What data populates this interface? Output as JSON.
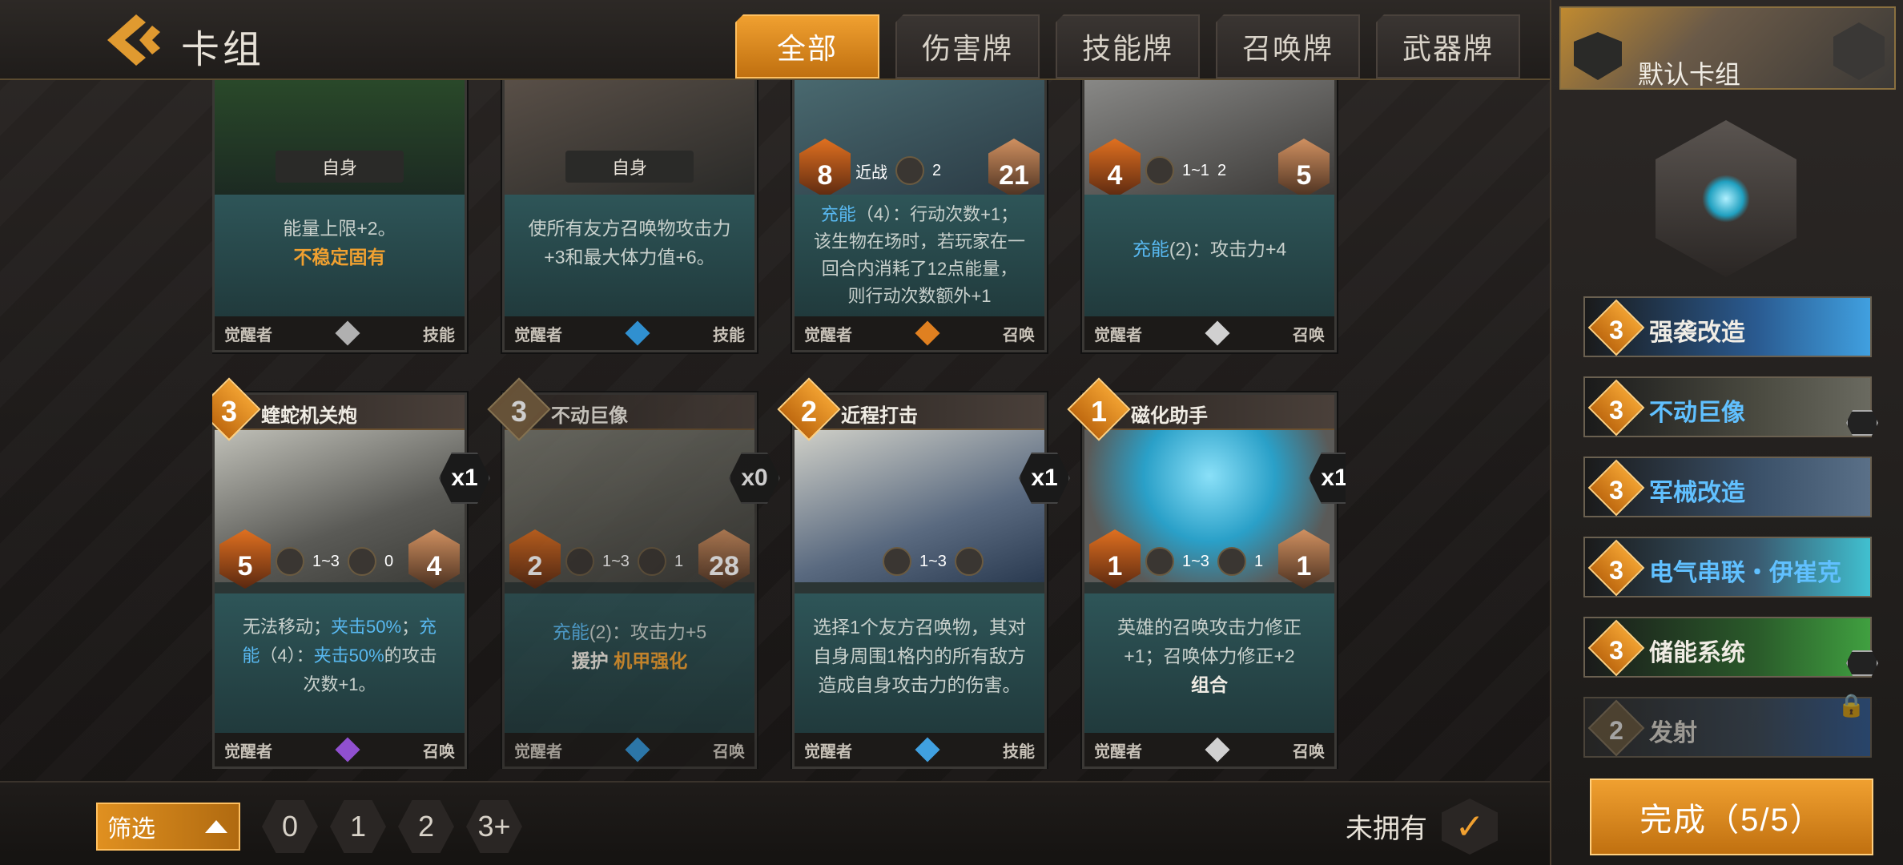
{
  "header": {
    "title": "卡组"
  },
  "tabs": [
    {
      "label": "全部",
      "active": true
    },
    {
      "label": "伤害牌"
    },
    {
      "label": "技能牌"
    },
    {
      "label": "召唤牌"
    },
    {
      "label": "武器牌"
    }
  ],
  "top_cards": [
    {
      "tag": "自身",
      "desc1": "能量上限+2。",
      "desc2": "不稳定固有",
      "owner": "觉醒者",
      "type": "技能",
      "gem": "#b0b0b0"
    },
    {
      "tag": "自身",
      "desc1": "使所有友方召唤物攻击力",
      "desc2": "+3和最大体力值+6。",
      "owner": "觉醒者",
      "type": "技能",
      "gem": "#3090d0"
    },
    {
      "atk": "8",
      "range": "近战",
      "spd": "2",
      "hp": "21",
      "kw": "充能",
      "desc1": "（4）：行动次数+1；",
      "desc2": "该生物在场时，若玩家在一",
      "desc3": "回合内消耗了12点能量，",
      "desc4": "则行动次数额外+1",
      "owner": "觉醒者",
      "type": "召唤",
      "gem": "#e08020"
    },
    {
      "atk": "4",
      "range": "1~1",
      "spd": "2",
      "hp": "5",
      "kw": "充能",
      "desc1": "(2)：攻击力+4",
      "owner": "觉醒者",
      "type": "召唤",
      "gem": "#d0d0d0"
    }
  ],
  "cards": [
    {
      "cost": "3",
      "name": "蝰蛇机关炮",
      "copies": "x1",
      "atk": "5",
      "range": "1~3",
      "spd": "0",
      "hp": "4",
      "d_a": "无法移动；",
      "d_b": "夹击50%",
      "d_c": "；",
      "d_d": "充",
      "d_e": "能",
      "d_f": "（4）：",
      "d_g": "夹击50%",
      "d_h": "的攻击",
      "d_i": "次数+1。",
      "owner": "觉醒者",
      "type": "召唤",
      "gem": "#9050d0"
    },
    {
      "cost": "3",
      "name": "不动巨像",
      "copies": "x0",
      "atk": "2",
      "range": "1~3",
      "spd": "1",
      "hp": "28",
      "kw": "充能",
      "d1": "(2)：攻击力+5",
      "d2a": "援护",
      "d2b": "机甲强化",
      "owner": "觉醒者",
      "type": "召唤",
      "gem": "#3090d0"
    },
    {
      "cost": "2",
      "name": "近程打击",
      "copies": "x1",
      "range": "1~3",
      "d1": "选择1个友方召唤物，其对",
      "d2": "自身周围1格内的所有敌方",
      "d3": "造成自身攻击力的伤害。",
      "owner": "觉醒者",
      "type": "技能",
      "gem": "#40a0e0"
    },
    {
      "cost": "1",
      "name": "磁化助手",
      "copies": "x1",
      "atk": "1",
      "range": "1~3",
      "spd": "1",
      "hp": "1",
      "d1": "英雄的召唤攻击力修正",
      "d2": "+1；召唤体力修正+2",
      "d3": "组合",
      "owner": "觉醒者",
      "type": "召唤",
      "gem": "#d0d0d0"
    }
  ],
  "deck": {
    "name": "默认卡组",
    "items": [
      {
        "cost": "3",
        "name": "强袭改造"
      },
      {
        "cost": "3",
        "name": "不动巨像"
      },
      {
        "cost": "3",
        "name": "军械改造"
      },
      {
        "cost": "3",
        "name": "电气串联・伊崔克"
      },
      {
        "cost": "3",
        "name": "储能系统"
      },
      {
        "cost": "2",
        "name": "发射",
        "locked": true
      }
    ]
  },
  "done_label": "完成（5/5）",
  "filter": {
    "label": "筛选",
    "costs": [
      "0",
      "1",
      "2",
      "3+"
    ]
  },
  "unowned_label": "未拥有",
  "check": "✓"
}
